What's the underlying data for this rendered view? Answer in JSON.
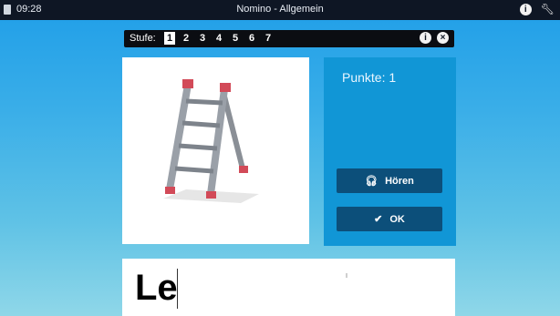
{
  "topbar": {
    "time": "09:28",
    "title": "Nomino - Allgemein",
    "icons": [
      "document-icon",
      "info-icon",
      "wrench-icon"
    ]
  },
  "stepbar": {
    "label": "Stufe:",
    "levels": [
      "1",
      "2",
      "3",
      "4",
      "5",
      "6",
      "7"
    ],
    "active_level": "1",
    "info_symbol": "i",
    "close_symbol": "×"
  },
  "image": {
    "subject": "ladder-illustration"
  },
  "score_panel": {
    "score_label": "Punkte: 1",
    "listen_button": "Hören",
    "ok_button": "OK"
  },
  "answer": {
    "text": "Le"
  },
  "colors": {
    "background_top": "#1f9ee8",
    "background_bottom": "#8fd7e8",
    "panel_blue": "#1196d6",
    "button_dark": "#0c4f7a",
    "bar_dark": "#0b0d12"
  }
}
